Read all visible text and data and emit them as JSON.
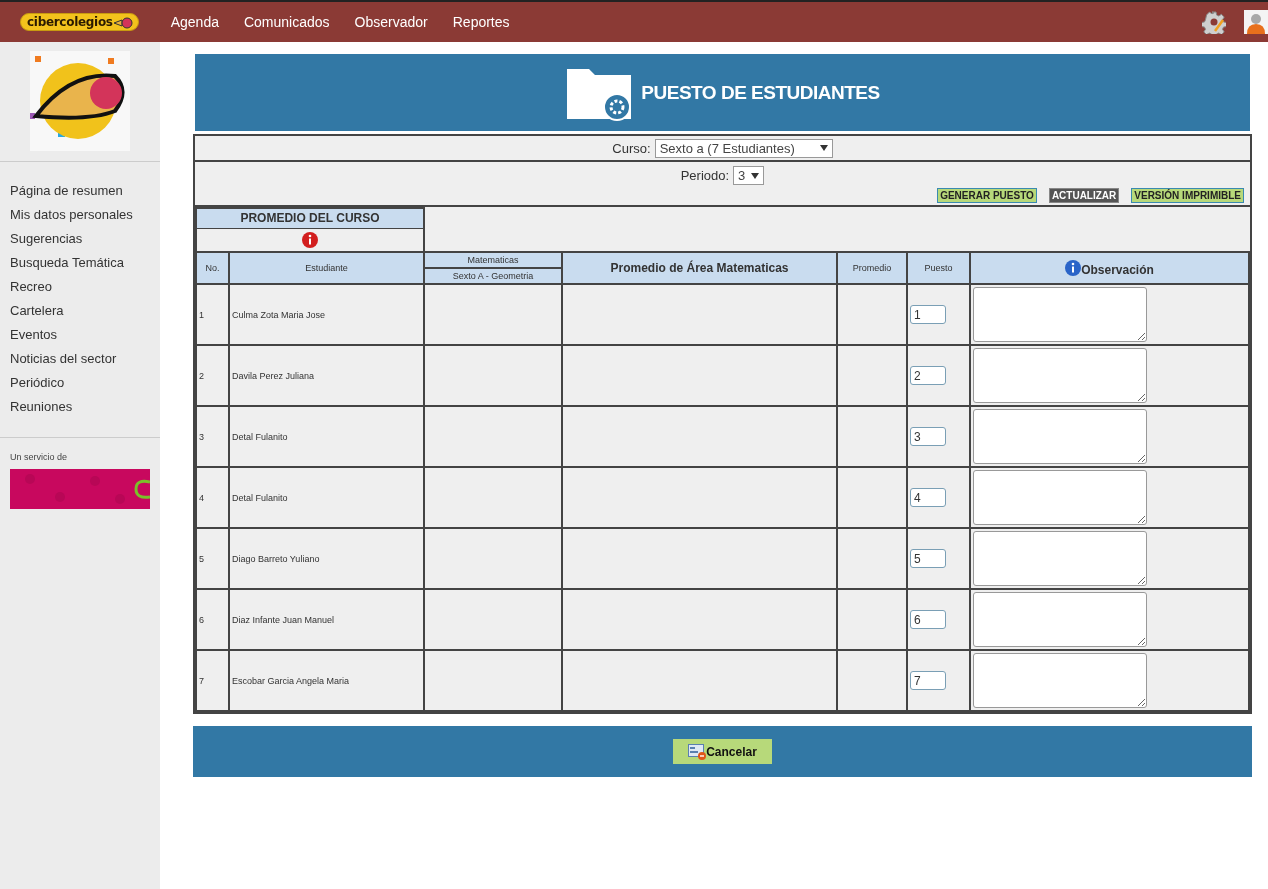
{
  "brand": "cibercolegios",
  "nav": [
    "Agenda",
    "Comunicados",
    "Observador",
    "Reportes"
  ],
  "sidebar": {
    "items": [
      "Página de resumen",
      "Mis datos personales",
      "Sugerencias",
      "Busqueda Temática",
      "Recreo",
      "Cartelera",
      "Eventos",
      "Noticias del sector",
      "Periódico",
      "Reuniones"
    ],
    "service_label": "Un servicio de"
  },
  "page_title": "PUESTO DE ESTUDIANTES",
  "curso": {
    "label": "Curso:",
    "value": "Sexto a (7 Estudiantes)"
  },
  "periodo": {
    "label": "Periodo:",
    "value": "3"
  },
  "actions": [
    {
      "label": "GENERAR PUESTO",
      "kind": "green"
    },
    {
      "label": "ACTUALIZAR",
      "kind": "dark"
    },
    {
      "label": "VERSIÓN IMPRIMIBLE",
      "kind": "green"
    }
  ],
  "course_average": {
    "title": "PROMEDIO DEL CURSO"
  },
  "table": {
    "columns": {
      "no": "No.",
      "student": "Estudiante",
      "subject": "Matematicas",
      "subject_group": "Sexto A - Geometria",
      "area": "Promedio de Área Matematicas",
      "average": "Promedio",
      "rank": "Puesto",
      "observation": "Observación"
    },
    "rows": [
      {
        "no": "1",
        "student": "Culma Zota Maria Jose",
        "rank": "1"
      },
      {
        "no": "2",
        "student": "Davila Perez Juliana",
        "rank": "2"
      },
      {
        "no": "3",
        "student": "Detal Fulanito",
        "rank": "3"
      },
      {
        "no": "4",
        "student": "Detal Fulanito",
        "rank": "4"
      },
      {
        "no": "5",
        "student": "Diago Barreto Yuliano",
        "rank": "5"
      },
      {
        "no": "6",
        "student": "Diaz Infante Juan Manuel",
        "rank": "6"
      },
      {
        "no": "7",
        "student": "Escobar Garcia Angela Maria",
        "rank": "7"
      }
    ]
  },
  "cancel_button": "Cancelar"
}
